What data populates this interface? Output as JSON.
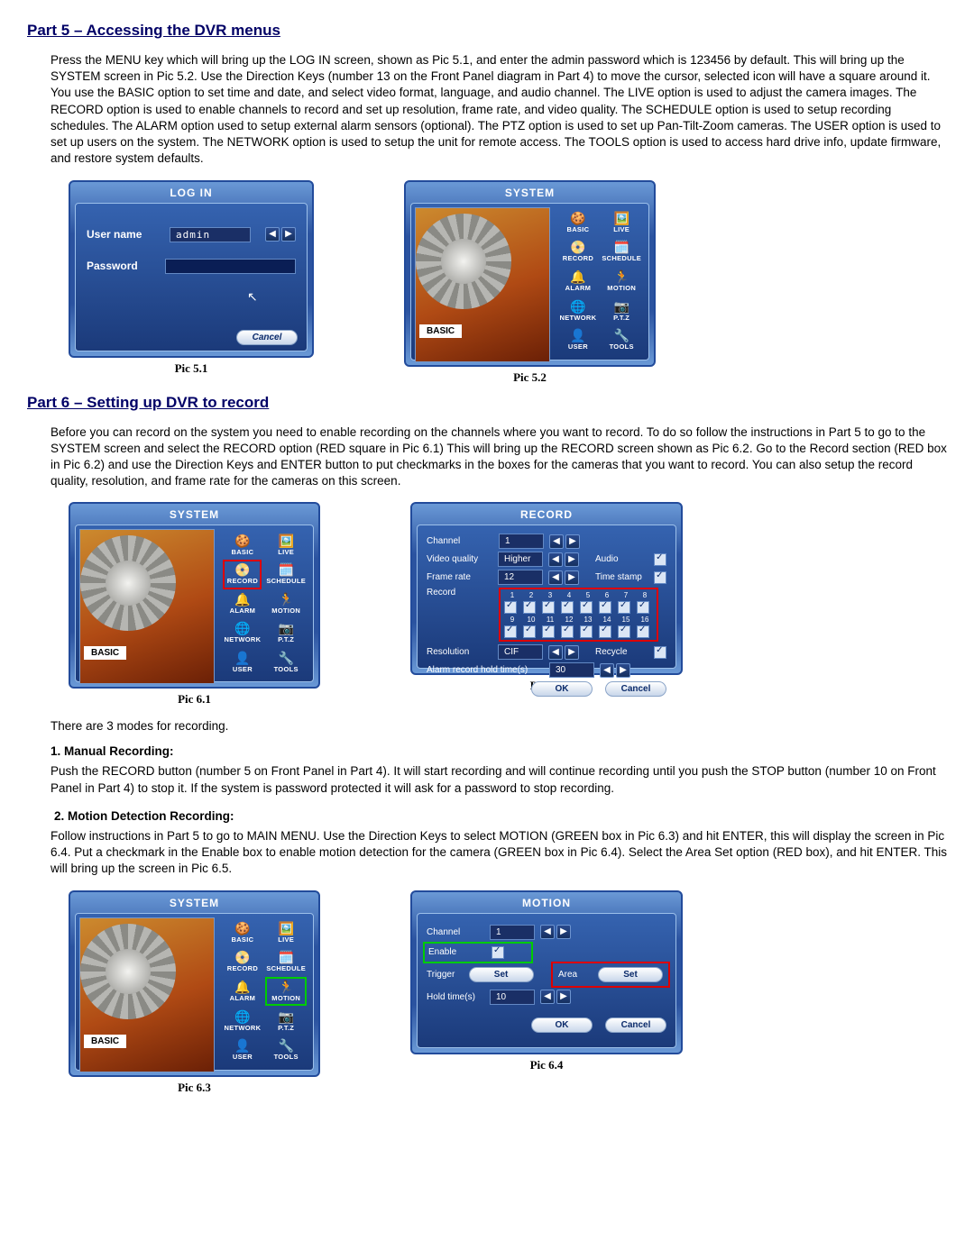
{
  "section5": {
    "title": "Part 5 – Accessing the DVR menus",
    "text": "Press the MENU key which will bring up the LOG IN screen, shown as Pic 5.1, and enter the admin password which is 123456 by default. This will bring up the SYSTEM screen in Pic 5.2. Use the Direction Keys (number 13 on the Front Panel diagram in Part 4) to move the cursor, selected icon will have a square around it. You use the BASIC option to set time and date, and select video format, language, and audio channel. The LIVE option is used to adjust the camera images. The RECORD option is used to enable channels to record and set up resolution, frame rate, and video quality. The SCHEDULE option is used to setup recording schedules. The ALARM option used to setup external alarm sensors (optional). The PTZ option is used to set up Pan-Tilt-Zoom cameras. The USER option is used to set up users on the system. The NETWORK option is used to setup the unit for remote access. The TOOLS option is used to access hard drive info, update firmware, and restore system defaults."
  },
  "login": {
    "title": "LOG IN",
    "username_label": "User name",
    "username_value": "admin",
    "password_label": "Password",
    "cancel": "Cancel",
    "caption": "Pic 5.1"
  },
  "system": {
    "title": "SYSTEM",
    "basic_tag": "BASIC",
    "items": [
      {
        "label": "BASIC",
        "icon": "🍪"
      },
      {
        "label": "LIVE",
        "icon": "🖼️"
      },
      {
        "label": "RECORD",
        "icon": "📀"
      },
      {
        "label": "SCHEDULE",
        "icon": "🗓️"
      },
      {
        "label": "ALARM",
        "icon": "🔔"
      },
      {
        "label": "MOTION",
        "icon": "🏃"
      },
      {
        "label": "NETWORK",
        "icon": "🌐"
      },
      {
        "label": "P.T.Z",
        "icon": "📷"
      },
      {
        "label": "USER",
        "icon": "👤"
      },
      {
        "label": "TOOLS",
        "icon": "🔧"
      }
    ],
    "caption": "Pic 5.2"
  },
  "section6": {
    "title": "Part 6 – Setting up DVR to record",
    "intro": "Before you can record on the system you need to enable recording on the channels where you want to record. To do so follow the instructions in Part 5 to go to the SYSTEM screen and select the RECORD option (RED square in Pic 6.1) This will bring up the RECORD screen shown as Pic 6.2. Go to the Record section (RED box in Pic 6.2) and use the Direction Keys and ENTER button to put checkmarks in the boxes for the cameras that you want to record. You can also setup the record quality, resolution, and frame rate for the cameras on this screen.",
    "caption61": "Pic 6.1",
    "caption62": "Pic 6.2",
    "modes_intro": "There are 3 modes for recording.",
    "manual_title": "1. Manual Recording:",
    "manual_text": "Push the RECORD button (number 5 on Front Panel in Part 4). It will start recording and will continue recording until you push the STOP button (number 10 on Front Panel in Part 4) to stop it. If the system is password protected it will ask for a password to stop recording.",
    "motion_title": "2. Motion Detection Recording:",
    "motion_text": "Follow instructions in Part 5 to go to MAIN MENU. Use the Direction Keys to select MOTION (GREEN box in Pic 6.3) and hit ENTER, this will display the screen in Pic 6.4. Put a checkmark in the Enable box to enable motion detection for the camera (GREEN box in Pic 6.4). Select the Area Set option (RED box), and hit ENTER. This will bring up the screen in Pic 6.5.",
    "caption63": "Pic 6.3",
    "caption64": "Pic 6.4"
  },
  "record": {
    "title": "RECORD",
    "channel_lbl": "Channel",
    "channel_val": "1",
    "vq_lbl": "Video quality",
    "vq_val": "Higher",
    "audio_lbl": "Audio",
    "fr_lbl": "Frame rate",
    "fr_val": "12",
    "ts_lbl": "Time stamp",
    "rec_lbl": "Record",
    "channels": [
      "1",
      "2",
      "3",
      "4",
      "5",
      "6",
      "7",
      "8",
      "9",
      "10",
      "11",
      "12",
      "13",
      "14",
      "15",
      "16"
    ],
    "res_lbl": "Resolution",
    "res_val": "CIF",
    "recycle_lbl": "Recycle",
    "arht_lbl": "Alarm record hold time(s)",
    "arht_val": "30",
    "ok": "OK",
    "cancel": "Cancel"
  },
  "motion": {
    "title": "MOTION",
    "channel_lbl": "Channel",
    "channel_val": "1",
    "enable_lbl": "Enable",
    "trigger_lbl": "Trigger",
    "set": "Set",
    "area_lbl": "Area",
    "ht_lbl": "Hold time(s)",
    "ht_val": "10",
    "ok": "OK",
    "cancel": "Cancel"
  }
}
